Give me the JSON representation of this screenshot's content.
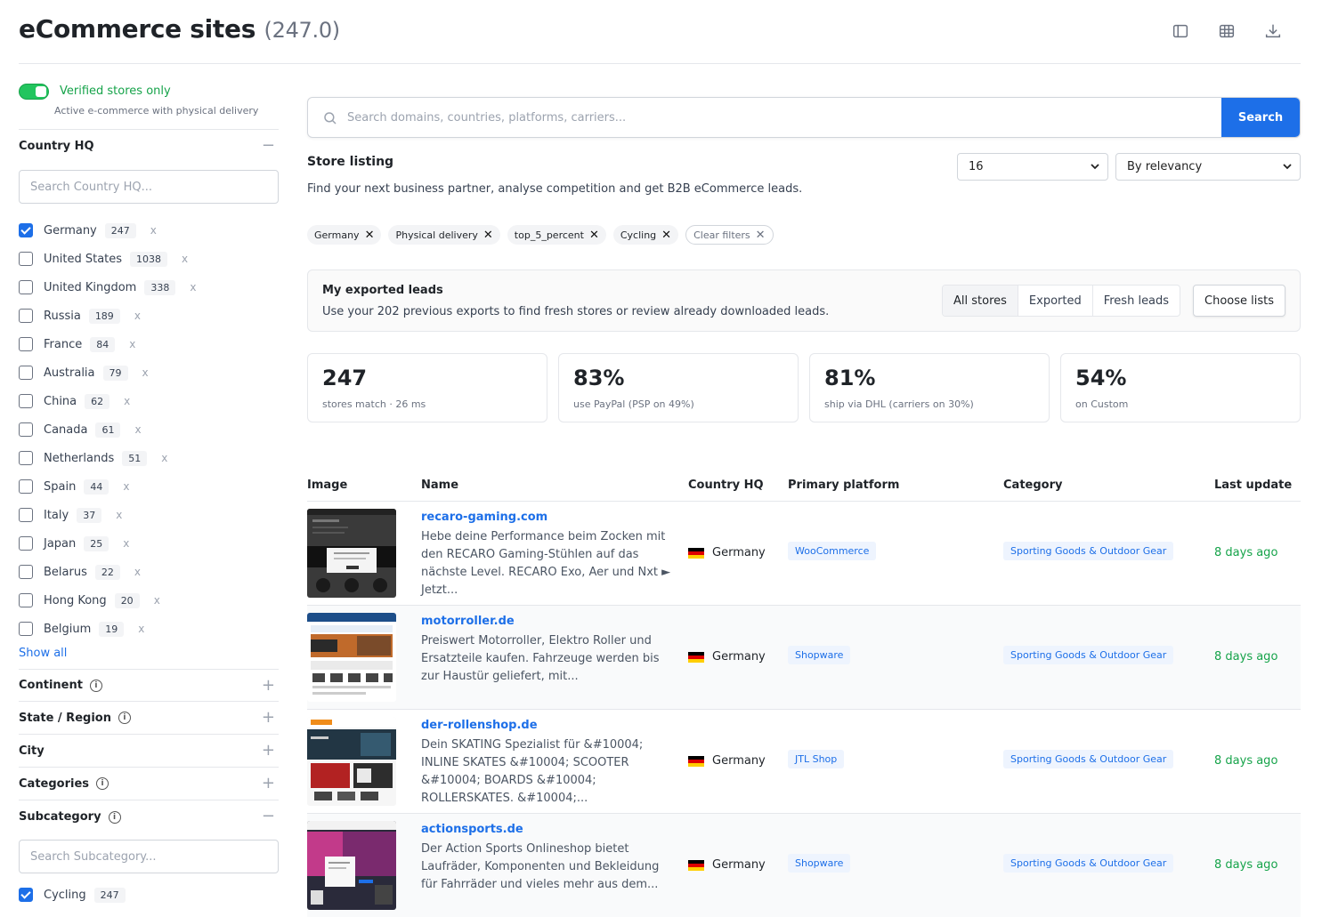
{
  "header": {
    "title": "eCommerce sites",
    "count": "(247.0)",
    "icons": [
      "sidebar-layout-icon",
      "table-grid-icon",
      "download-icon"
    ]
  },
  "sidebar": {
    "verified_label": "Verified stores only",
    "verified_sub": "Active e-commerce with physical delivery",
    "country_hq": {
      "label": "Country HQ",
      "search_placeholder": "Search Country HQ...",
      "items": [
        {
          "name": "Germany",
          "count": "247",
          "checked": true
        },
        {
          "name": "United States",
          "count": "1038",
          "checked": false
        },
        {
          "name": "United Kingdom",
          "count": "338",
          "checked": false
        },
        {
          "name": "Russia",
          "count": "189",
          "checked": false
        },
        {
          "name": "France",
          "count": "84",
          "checked": false
        },
        {
          "name": "Australia",
          "count": "79",
          "checked": false
        },
        {
          "name": "China",
          "count": "62",
          "checked": false
        },
        {
          "name": "Canada",
          "count": "61",
          "checked": false
        },
        {
          "name": "Netherlands",
          "count": "51",
          "checked": false
        },
        {
          "name": "Spain",
          "count": "44",
          "checked": false
        },
        {
          "name": "Italy",
          "count": "37",
          "checked": false
        },
        {
          "name": "Japan",
          "count": "25",
          "checked": false
        },
        {
          "name": "Belarus",
          "count": "22",
          "checked": false
        },
        {
          "name": "Hong Kong",
          "count": "20",
          "checked": false
        },
        {
          "name": "Belgium",
          "count": "19",
          "checked": false
        }
      ],
      "remove_mark": "x",
      "show_all": "Show all"
    },
    "continent": "Continent",
    "state_region": "State / Region",
    "city": "City",
    "categories": "Categories",
    "subcategory": {
      "label": "Subcategory",
      "search_placeholder": "Search Subcategory...",
      "items": [
        {
          "name": "Cycling",
          "count": "247",
          "checked": true
        }
      ]
    },
    "plus": "+",
    "minus": "−",
    "info": "i"
  },
  "main": {
    "search_placeholder": "Search domains, countries, platforms, carriers...",
    "search_button": "Search",
    "listing_title": "Store listing",
    "listing_sub": "Find your next business partner, analyse competition and get B2B eCommerce leads.",
    "page_size": "16",
    "sort": "By relevancy",
    "chips": [
      "Germany",
      "Physical delivery",
      "top_5_percent",
      "Cycling"
    ],
    "clear_filters": "Clear filters",
    "leads": {
      "title": "My exported leads",
      "sub": "Use your 202 previous exports to find fresh stores or review already downloaded leads.",
      "segments": [
        "All stores",
        "Exported",
        "Fresh leads"
      ],
      "choose": "Choose lists"
    },
    "stats": [
      {
        "big": "247",
        "small": "stores match · 26 ms"
      },
      {
        "big": "83%",
        "small": "use PayPal (PSP on 49%)"
      },
      {
        "big": "81%",
        "small": "ship via DHL (carriers on 30%)"
      },
      {
        "big": "54%",
        "small": "on Custom"
      }
    ],
    "columns": [
      "Image",
      "Name",
      "Country HQ",
      "Primary platform",
      "Category",
      "Last update"
    ],
    "rows": [
      {
        "domain": "recaro-gaming.com",
        "desc": "Hebe deine Performance beim Zocken mit den RECARO Gaming-Stühlen auf das nächste Level. RECARO Exo, Aer und Nxt ► Jetzt...",
        "country": "Germany",
        "platform": "WooCommerce",
        "category": "Sporting Goods & Outdoor Gear",
        "updated": "8 days ago"
      },
      {
        "domain": "motorroller.de",
        "desc": "Preiswert Motorroller, Elektro Roller und Ersatzteile kaufen. Fahrzeuge werden bis zur Haustür geliefert, mit...",
        "country": "Germany",
        "platform": "Shopware",
        "category": "Sporting Goods & Outdoor Gear",
        "updated": "8 days ago"
      },
      {
        "domain": "der-rollenshop.de",
        "desc": "Dein SKATING Spezialist für &#10004; INLINE SKATES &#10004; SCOOTER &#10004; BOARDS &#10004; ROLLERSKATES. &#10004;...",
        "country": "Germany",
        "platform": "JTL Shop",
        "category": "Sporting Goods & Outdoor Gear",
        "updated": "8 days ago"
      },
      {
        "domain": "actionsports.de",
        "desc": "Der Action Sports Onlineshop bietet Laufräder, Komponenten und Bekleidung für Fahrräder und vieles mehr aus dem...",
        "country": "Germany",
        "platform": "Shopware",
        "category": "Sporting Goods & Outdoor Gear",
        "updated": "8 days ago"
      }
    ]
  },
  "colors": {
    "accent": "#1d6fe8",
    "success": "#16a34a",
    "border": "#e5e7eb"
  }
}
